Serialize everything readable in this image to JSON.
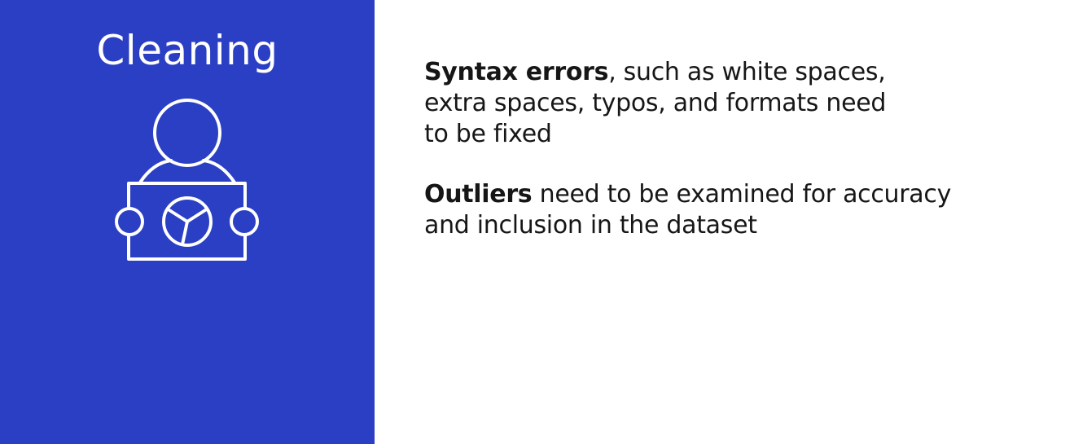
{
  "panel": {
    "title": "Cleaning",
    "icon": "person-holding-chart-icon",
    "background": "#2b3fc4"
  },
  "points": [
    {
      "lead": "Syntax errors",
      "line1": ", such as white spaces,",
      "line2": "extra spaces, typos, and formats need",
      "line3": "to be fixed"
    },
    {
      "lead": "Outliers",
      "line1": " need to be examined for accuracy",
      "line2": "and inclusion in the dataset"
    }
  ]
}
